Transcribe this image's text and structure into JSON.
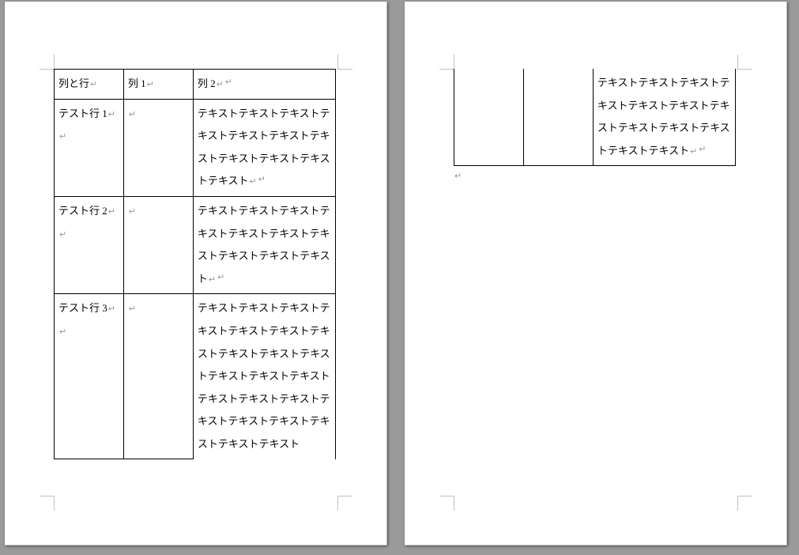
{
  "paragraph_mark": "↵",
  "table_mark": "↵",
  "table": {
    "headers": [
      "列と行",
      "列 1",
      "列 2"
    ],
    "rows": [
      {
        "label": "テスト行 1",
        "col1": "",
        "col2_page1": "テキストテキストテキストテキストテキストテキストテキストテキストテキストテキストテキスト",
        "col2_page2": ""
      },
      {
        "label": "テスト行 2",
        "col1": "",
        "col2_page1": "テキストテキストテキストテキストテキストテキストテキストテキストテキストテキスト",
        "col2_page2": ""
      },
      {
        "label": "テスト行 3",
        "col1": "",
        "col2_page1": "テキストテキストテキストテキストテキストテキストテキストテキストテキストテキストテキストテキストテキストテキストテキストテキストテキストテキストテキストテキストテキストテキスト",
        "col2_page2": "テキストテキストテキストテキストテキストテキストテキストテキストテキストテキストテキストテキスト"
      }
    ]
  }
}
